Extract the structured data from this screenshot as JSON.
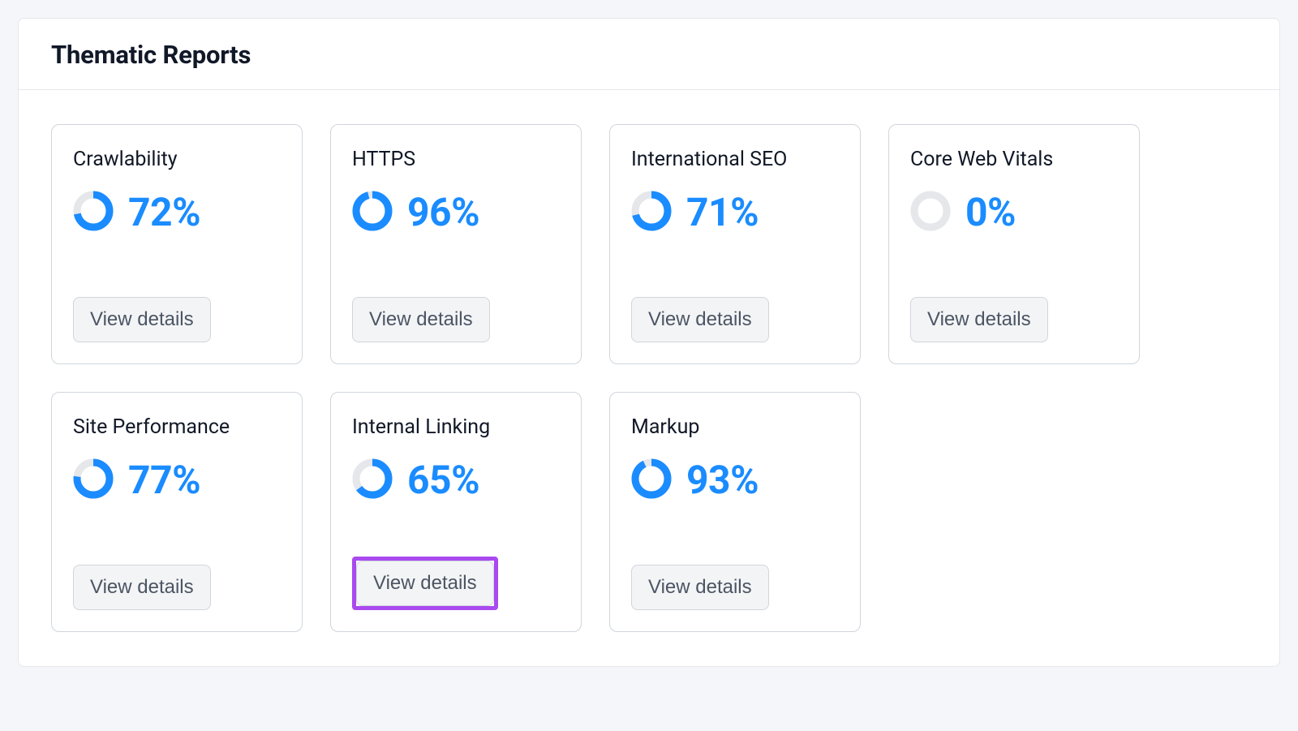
{
  "panel": {
    "title": "Thematic Reports",
    "view_details_label": "View details",
    "colors": {
      "accent": "#1a8cff",
      "ring_track": "#e5e7eb",
      "highlight": "#a94af0"
    }
  },
  "reports": [
    {
      "id": "crawlability",
      "title": "Crawlability",
      "value": 72,
      "display": "72%",
      "highlight": false
    },
    {
      "id": "https",
      "title": "HTTPS",
      "value": 96,
      "display": "96%",
      "highlight": false
    },
    {
      "id": "international-seo",
      "title": "International SEO",
      "value": 71,
      "display": "71%",
      "highlight": false
    },
    {
      "id": "core-web-vitals",
      "title": "Core Web Vitals",
      "value": 0,
      "display": "0%",
      "highlight": false
    },
    {
      "id": "site-performance",
      "title": "Site Performance",
      "value": 77,
      "display": "77%",
      "highlight": false
    },
    {
      "id": "internal-linking",
      "title": "Internal Linking",
      "value": 65,
      "display": "65%",
      "highlight": true
    },
    {
      "id": "markup",
      "title": "Markup",
      "value": 93,
      "display": "93%",
      "highlight": false
    }
  ]
}
